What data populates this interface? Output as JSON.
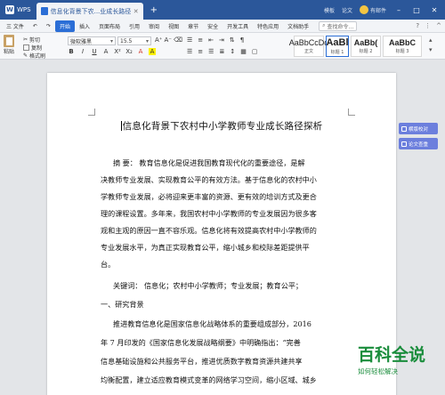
{
  "titlebar": {
    "app": "WPS",
    "doc_tab": "信息化背景下农...业成长路径探析",
    "right_items": [
      "模板",
      "论文",
      "有邮件"
    ]
  },
  "menubar": {
    "file": "三 文件",
    "items": [
      "开始",
      "插入",
      "页面布局",
      "引用",
      "审阅",
      "视图",
      "章节",
      "安全",
      "开发工具",
      "特色应用",
      "文档助手"
    ],
    "active": "开始",
    "search": "查找命令..."
  },
  "ribbon": {
    "paste": "粘贴",
    "cut": "剪切",
    "copy": "复制",
    "format_painter": "格式刷",
    "font": "微软雅黑",
    "size": "15.5",
    "format_buttons": [
      "B",
      "I",
      "U",
      "A",
      "X²",
      "X₂",
      "A",
      "A"
    ],
    "styles": [
      {
        "sample": "AaBbCcDd",
        "caption": "正文"
      },
      {
        "sample": "AaBl",
        "caption": "标题 1"
      },
      {
        "sample": "AaBb(",
        "caption": "标题 2"
      },
      {
        "sample": "AaBbC",
        "caption": "标题 3"
      }
    ]
  },
  "document": {
    "title": "信息化背景下农村中小学教师专业成长路径探析",
    "lines": [
      "摘    要：  教育信息化是促进我国教育现代化的重要途径，是解",
      "决教师专业发展、实现教育公平的有效方法。基于信息化的农村中小",
      "学教师专业发展，必将迎来更丰富的资源、更有效的培训方式及更合",
      "理的课程设置。多年来，我国农村中小学教师的专业发展因为很多客",
      "观和主观的原因一直不容乐观。信息化将有效提高农村中小学教师的",
      "专业发展水平，为真正实现教育公平，缩小城乡和校际差距提供平",
      "台。",
      "关键词：    信息化；农村中小学教师；专业发展；教育公平；",
      "一、研究背景",
      "推进教育信息化是国家信息化战略体系的重要组成部分，2016",
      "年 7 月印发的《国家信息化发展战略纲要》中明确指出：“完善",
      "信息基础设施和公共服务平台，推进优质数字教育资源共建共享",
      "均衡配置，建立适应教育模式变革的网络学习空间，缩小区域、城乡"
    ]
  },
  "side_buttons": [
    "横版校对",
    "论文查重"
  ],
  "watermark": {
    "main": "百科全说",
    "sub": "如何轻松解决"
  }
}
